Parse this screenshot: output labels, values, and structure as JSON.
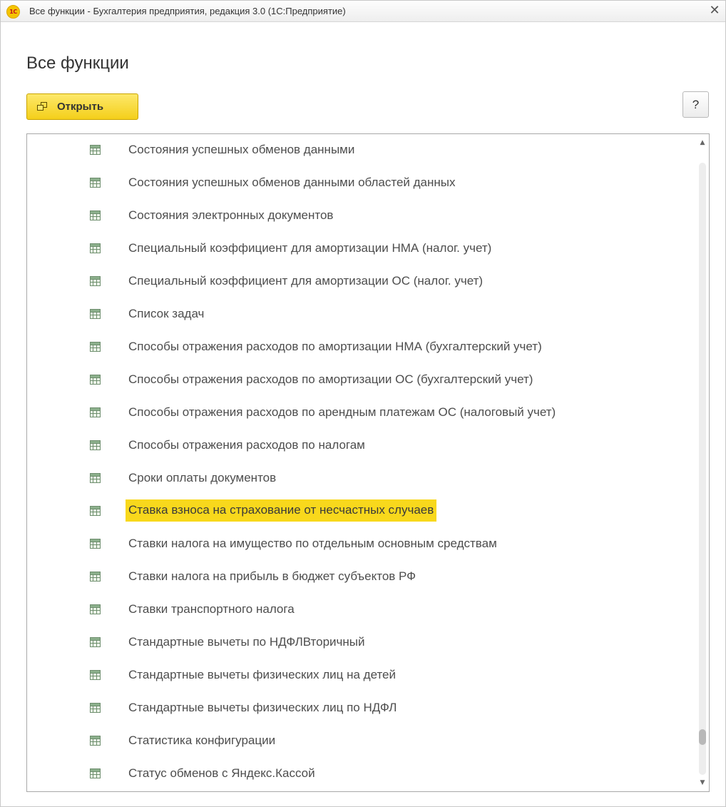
{
  "window": {
    "title": "Все функции - Бухгалтерия предприятия, редакция 3.0  (1С:Предприятие)",
    "logo_text": "1С",
    "close_glyph": "✕"
  },
  "page": {
    "title": "Все функции"
  },
  "toolbar": {
    "open_label": "Открыть",
    "help_label": "?"
  },
  "list": {
    "icon": "table-register-icon",
    "selected_index": 11,
    "items": [
      "Состояния успешных обменов данными",
      "Состояния успешных обменов данными областей данных",
      "Состояния электронных документов",
      "Специальный коэффициент для амортизации НМА (налог. учет)",
      "Специальный коэффициент для амортизации ОС (налог. учет)",
      "Список задач",
      "Способы отражения расходов по амортизации НМА (бухгалтерский учет)",
      "Способы отражения расходов по амортизации ОС (бухгалтерский учет)",
      "Способы отражения расходов по арендным платежам ОС (налоговый учет)",
      "Способы отражения расходов по налогам",
      "Сроки оплаты документов",
      "Ставка взноса на страхование от несчастных случаев",
      "Ставки налога на имущество по отдельным основным средствам",
      "Ставки налога на прибыль в бюджет субъектов РФ",
      "Ставки транспортного налога",
      "Стандартные вычеты по НДФЛВторичный",
      "Стандартные вычеты физических лиц на детей",
      "Стандартные вычеты физических лиц по НДФЛ",
      "Статистика конфигурации",
      "Статус обменов с Яндекс.Кассой"
    ]
  },
  "scrollbar": {
    "up_glyph": "▲",
    "down_glyph": "▼",
    "position": 0.95
  },
  "colors": {
    "accent": "#f4cf1a",
    "selection": "#f8d81c"
  }
}
